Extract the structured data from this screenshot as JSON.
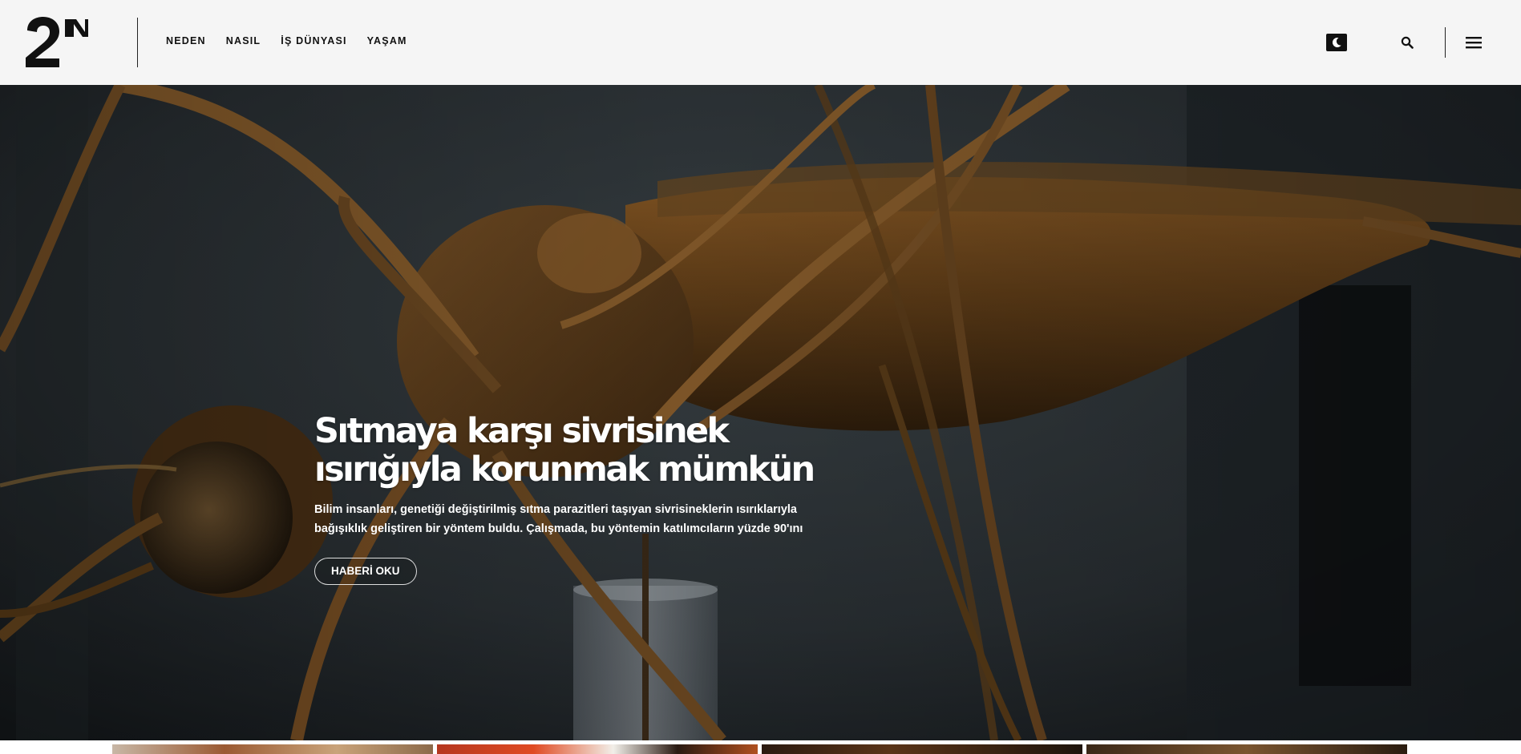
{
  "header": {
    "logo_alt": "2N",
    "nav": [
      {
        "label": "NEDEN"
      },
      {
        "label": "NASIL"
      },
      {
        "label": "İŞ DÜNYASI"
      },
      {
        "label": "YAŞAM"
      }
    ],
    "icons": {
      "theme": "moon-icon",
      "search": "search-icon",
      "menu": "hamburger-menu-icon"
    }
  },
  "hero": {
    "title": "Sıtmaya karşı sivrisinek ısırığıyla korunmak mümkün",
    "summary": "Bilim insanları, genetiği değiştirilmiş sıtma parazitleri taşıyan sivrisineklerin ısırıklarıyla bağışıklık geliştiren bir yöntem buldu. Çalışmada, bu yöntemin katılımcıların yüzde 90'ını",
    "button_label": "HABERİ OKU"
  },
  "colors": {
    "header_bg": "#f5f5f5",
    "text_dark": "#111111",
    "hero_text": "#ffffff"
  }
}
